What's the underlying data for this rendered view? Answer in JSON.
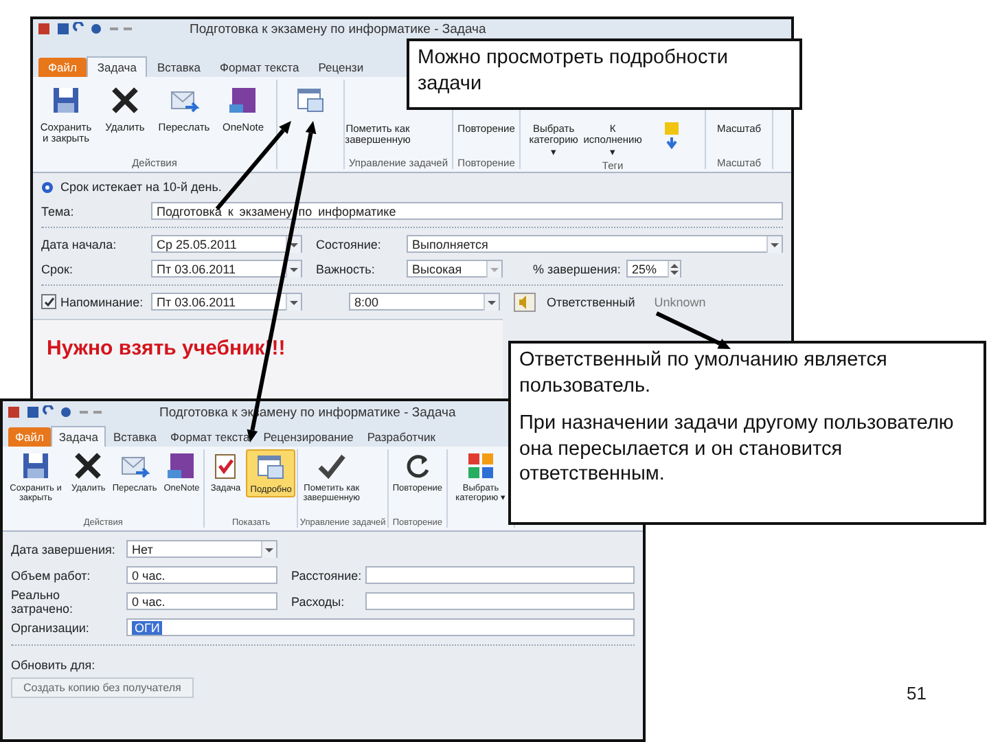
{
  "back_window": {
    "title": "Подготовка к экзамену по информатике - Задача",
    "tabs": [
      {
        "label": "Файл",
        "kind": "file",
        "selected": false
      },
      {
        "label": "Задача",
        "kind": "tab",
        "selected": true
      },
      {
        "label": "Вставка",
        "kind": "tab",
        "selected": false
      },
      {
        "label": "Формат текста",
        "kind": "tab",
        "selected": false
      },
      {
        "label": "Рецензи",
        "kind": "tab",
        "selected": false
      }
    ],
    "ribbon": [
      {
        "group": "Действия",
        "buttons": [
          {
            "label": "Сохранить и закрыть",
            "kind": "save"
          },
          {
            "label": "Удалить",
            "kind": "delete"
          },
          {
            "label": "Переслать",
            "kind": "forward"
          },
          {
            "label": "OneNote",
            "kind": "onenote"
          }
        ]
      },
      {
        "buttons": [
          {
            "kind": "details"
          }
        ]
      },
      {
        "group": "Управление задачей",
        "buttons": [
          {
            "label": "Пометить как завершенную",
            "kind": "hidden"
          }
        ]
      },
      {
        "group": "Повторение",
        "buttons": [
          {
            "label": "Повторение",
            "kind": "hidden"
          }
        ]
      },
      {
        "group": "Теги",
        "buttons": [
          {
            "label": "Выбрать категорию ▾",
            "kind": "hidden"
          },
          {
            "label": "К исполнению ▾",
            "kind": "hidden"
          },
          {
            "kind": "flag"
          }
        ]
      },
      {
        "group": "Масштаб",
        "buttons": [
          {
            "label": "Масштаб",
            "kind": "hidden"
          }
        ]
      }
    ],
    "info": "Срок истекает на 10-й день.",
    "subject": {
      "label": "Тема:",
      "value": "Подготовка к экзамену по информатике"
    },
    "start": {
      "label": "Дата начала:",
      "value": "Ср 25.05.2011"
    },
    "status": {
      "label": "Состояние:",
      "value": "Выполняется"
    },
    "due": {
      "label": "Срок:",
      "value": "Пт 03.06.2011"
    },
    "priority": {
      "label": "Важность:",
      "value": "Высокая"
    },
    "complete": {
      "label": "% завершения:",
      "value": "25%"
    },
    "reminder": {
      "label": "Напоминание:",
      "checked": true,
      "date": "Пт 03.06.2011",
      "time": "8:00"
    },
    "owner": {
      "label": "Ответственный",
      "value": "Unknown"
    },
    "note": "Нужно взять учебник!!!"
  },
  "front_window": {
    "title": "Подготовка к экзамену по информатике - Задача",
    "tabs": [
      {
        "label": "Файл",
        "kind": "file",
        "selected": false
      },
      {
        "label": "Задача",
        "kind": "tab",
        "selected": true
      },
      {
        "label": "Вставка",
        "kind": "tab",
        "selected": false
      },
      {
        "label": "Формат текста",
        "kind": "tab",
        "selected": false
      },
      {
        "label": "Рецензирование",
        "kind": "tab",
        "selected": false
      },
      {
        "label": "Разработчик",
        "kind": "tab",
        "selected": false
      }
    ],
    "ribbon": [
      {
        "group": "Действия",
        "buttons": [
          {
            "label": "Сохранить и закрыть",
            "kind": "save",
            "selected": false
          },
          {
            "label": "Удалить",
            "kind": "delete",
            "selected": false
          },
          {
            "label": "Переслать",
            "kind": "forward",
            "selected": false
          },
          {
            "label": "OneNote",
            "kind": "onenote",
            "selected": false
          }
        ]
      },
      {
        "group": "Показать",
        "buttons": [
          {
            "label": "Задача",
            "kind": "task",
            "selected": false
          },
          {
            "label": "Подробно",
            "kind": "details",
            "selected": true
          }
        ]
      },
      {
        "group": "Управление задачей",
        "buttons": [
          {
            "label": "Пометить как завершенную",
            "kind": "check",
            "selected": false
          }
        ]
      },
      {
        "group": "Повторение",
        "buttons": [
          {
            "label": "Повторение",
            "kind": "repeat",
            "selected": false
          }
        ]
      },
      {
        "buttons": [
          {
            "label": "Выбрать категорию ▾",
            "kind": "categories",
            "selected": false
          }
        ]
      }
    ],
    "date_completed": {
      "label": "Дата завершения:",
      "value": "Нет"
    },
    "work": {
      "label": "Объем работ:",
      "value": "0 час."
    },
    "mileage": {
      "label": "Расстояние:"
    },
    "actual": {
      "label": "Реально затрачено:",
      "value": "0 час."
    },
    "billing": {
      "label": "Расходы:"
    },
    "companies": {
      "label": "Организации:",
      "value": "ОГИ"
    },
    "update_list": "Обновить для:",
    "copy_button": "Создать копию без получателя"
  },
  "callouts": [
    {
      "text": "Можно просмотреть подробности задачи"
    },
    {
      "text": "Ответственный по умолчанию является пользователь.\nПри назначении задачи другому пользователю она пересылается и он становится ответственным."
    }
  ],
  "page_number": "51"
}
